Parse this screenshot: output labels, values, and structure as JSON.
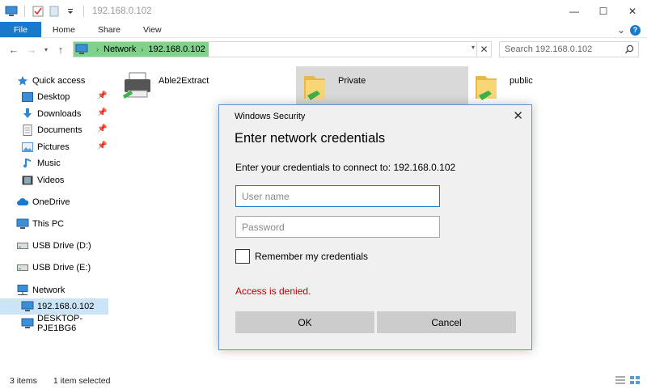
{
  "window": {
    "title": "192.168.0.102",
    "controls": {
      "minimize": "—",
      "maximize": "☐",
      "close": "✕"
    }
  },
  "qat_icons": [
    "computer-icon",
    "properties-icon",
    "new-folder-icon",
    "customize-chevron-icon"
  ],
  "ribbon": {
    "tabs": [
      "File",
      "Home",
      "Share",
      "View"
    ],
    "expand_glyph": "⌄",
    "help_glyph": "?"
  },
  "address": {
    "segments": [
      "Network",
      "192.168.0.102"
    ],
    "search_placeholder": "Search 192.168.0.102"
  },
  "nav": {
    "quick_access": "Quick access",
    "quick_items": [
      {
        "label": "Desktop",
        "icon": "desktop-icon",
        "pinned": true
      },
      {
        "label": "Downloads",
        "icon": "downloads-icon",
        "pinned": true
      },
      {
        "label": "Documents",
        "icon": "documents-icon",
        "pinned": true
      },
      {
        "label": "Pictures",
        "icon": "pictures-icon",
        "pinned": true
      },
      {
        "label": "Music",
        "icon": "music-icon",
        "pinned": false
      },
      {
        "label": "Videos",
        "icon": "videos-icon",
        "pinned": false
      }
    ],
    "onedrive": "OneDrive",
    "this_pc": "This PC",
    "usb_d": "USB Drive (D:)",
    "usb_e": "USB Drive (E:)",
    "network": "Network",
    "network_items": [
      "192.168.0.102",
      "DESKTOP-PJE1BG6"
    ],
    "selected": "192.168.0.102"
  },
  "content": {
    "items": [
      {
        "label": "Able2Extract",
        "icon": "printer-icon"
      },
      {
        "label": "Private",
        "icon": "shared-folder-icon",
        "selected": true
      },
      {
        "label": "public",
        "icon": "shared-folder-icon"
      }
    ]
  },
  "status": {
    "count": "3 items",
    "selection": "1 item selected"
  },
  "dialog": {
    "caption": "Windows Security",
    "heading": "Enter network credentials",
    "message": "Enter your credentials to connect to: 192.168.0.102",
    "username_placeholder": "User name",
    "password_placeholder": "Password",
    "remember_label": "Remember my credentials",
    "error": "Access is denied.",
    "ok_label": "OK",
    "cancel_label": "Cancel"
  },
  "colors": {
    "accent": "#1979ca",
    "address_highlight": "#7fd18b",
    "selection": "#cce4f7",
    "error": "#c00000",
    "dialog_bg": "#f0f0f0"
  }
}
